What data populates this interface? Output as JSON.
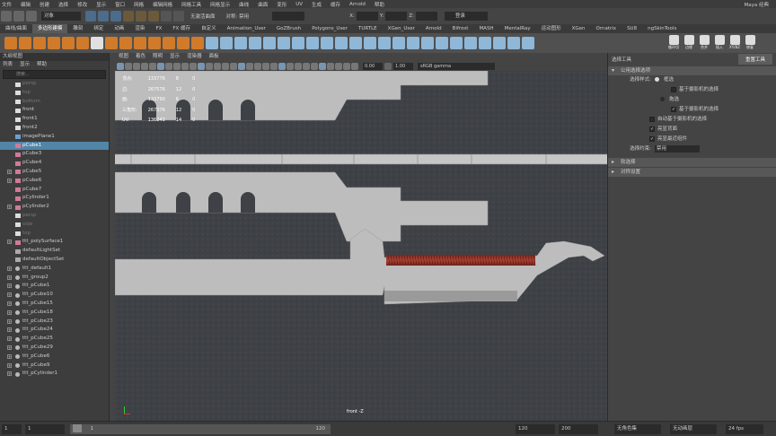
{
  "menubar": {
    "items": [
      "文件",
      "编辑",
      "创建",
      "选择",
      "修改",
      "显示",
      "窗口",
      "网格",
      "编辑网格",
      "网格工具",
      "网格显示",
      "曲线",
      "曲面",
      "变形",
      "UV",
      "生成",
      "缓存",
      "Arnold",
      "帮助"
    ],
    "workspace_label": "Maya 经典"
  },
  "statusline": {
    "mode_label": "对象",
    "live_surface": "无激活曲面",
    "symmetry": "对称: 禁用",
    "login": "登录",
    "coord_x": "X:",
    "coord_y": "Y:",
    "coord_z": "Z:"
  },
  "shelf_tabs": [
    "曲线/曲面",
    "多边形建模",
    "雕刻",
    "绑定",
    "动画",
    "渲染",
    "FX",
    "FX 缓存",
    "自定义",
    "Animation_User",
    "GoZBrush",
    "Polygons_User",
    "TURTLE",
    "XGen_User",
    "Arnold",
    "Bifrost",
    "MASH",
    "MentalRay",
    "运动图形",
    "XGen",
    "Ornatrix",
    "SU8",
    "ngSkinTools"
  ],
  "shelf_active_tab_index": 1,
  "shelf_right_labels": [
    "循环切",
    "边缘",
    "合并",
    "插入",
    "XY/BZ",
    "修复"
  ],
  "outliner": {
    "title": "大纲视图",
    "menu": [
      "列表",
      "显示",
      "帮助"
    ],
    "search_placeholder": "搜索...",
    "rows": [
      {
        "label": "persp",
        "kind": "camera",
        "dim": true,
        "expand": false
      },
      {
        "label": "top",
        "kind": "camera",
        "dim": true,
        "expand": false
      },
      {
        "label": "bottom",
        "kind": "camera",
        "dim": true,
        "expand": false
      },
      {
        "label": "front",
        "kind": "camera",
        "dim": false,
        "expand": false
      },
      {
        "label": "front1",
        "kind": "camera",
        "dim": false,
        "expand": false
      },
      {
        "label": "front2",
        "kind": "camera",
        "dim": false,
        "expand": false
      },
      {
        "label": "imagePlane1",
        "kind": "image",
        "dim": false,
        "expand": false
      },
      {
        "label": "pCube1",
        "kind": "mesh",
        "dim": false,
        "expand": false,
        "selected": true
      },
      {
        "label": "pCube3",
        "kind": "mesh",
        "dim": false,
        "expand": false
      },
      {
        "label": "pCube4",
        "kind": "mesh",
        "dim": false,
        "expand": false
      },
      {
        "label": "pCube5",
        "kind": "mesh",
        "dim": false,
        "expand": true
      },
      {
        "label": "pCube6",
        "kind": "mesh",
        "dim": false,
        "expand": true
      },
      {
        "label": "pCube7",
        "kind": "mesh",
        "dim": false,
        "expand": false
      },
      {
        "label": "pCylinder1",
        "kind": "mesh",
        "dim": false,
        "expand": false
      },
      {
        "label": "pCylinder2",
        "kind": "mesh",
        "dim": false,
        "expand": true
      },
      {
        "label": "persp",
        "kind": "camera",
        "dim": true,
        "expand": false
      },
      {
        "label": "side",
        "kind": "camera",
        "dim": true,
        "expand": false
      },
      {
        "label": "top",
        "kind": "camera",
        "dim": true,
        "expand": false
      },
      {
        "label": "ttt_polySurface1",
        "kind": "mesh",
        "dim": false,
        "expand": true
      },
      {
        "label": "defaultLightSet",
        "kind": "set",
        "dim": false,
        "expand": false
      },
      {
        "label": "defaultObjectSet",
        "kind": "set",
        "dim": false,
        "expand": false
      },
      {
        "label": "ttt_default1",
        "kind": "group",
        "dim": false,
        "expand": true
      },
      {
        "label": "ttt_group2",
        "kind": "group",
        "dim": false,
        "expand": true
      },
      {
        "label": "ttt_pCube1",
        "kind": "group",
        "dim": false,
        "expand": true
      },
      {
        "label": "ttt_pCube10",
        "kind": "group",
        "dim": false,
        "expand": true
      },
      {
        "label": "ttt_pCube15",
        "kind": "group",
        "dim": false,
        "expand": true
      },
      {
        "label": "ttt_pCube18",
        "kind": "group",
        "dim": false,
        "expand": true
      },
      {
        "label": "ttt_pCube23",
        "kind": "group",
        "dim": false,
        "expand": true
      },
      {
        "label": "ttt_pCube24",
        "kind": "group",
        "dim": false,
        "expand": true
      },
      {
        "label": "ttt_pCube25",
        "kind": "group",
        "dim": false,
        "expand": true
      },
      {
        "label": "ttt_pCube29",
        "kind": "group",
        "dim": false,
        "expand": true
      },
      {
        "label": "ttt_pCube6",
        "kind": "group",
        "dim": false,
        "expand": true
      },
      {
        "label": "ttt_pCube9",
        "kind": "group",
        "dim": false,
        "expand": true
      },
      {
        "label": "ttt_pCylinder1",
        "kind": "group",
        "dim": false,
        "expand": true
      }
    ]
  },
  "viewport": {
    "menu": [
      "视图",
      "着色",
      "照明",
      "显示",
      "渲染器",
      "面板"
    ],
    "exposure": "0.00",
    "gamma": "1.00",
    "color_space": "sRGB gamma",
    "camera_label": "front -Z",
    "hud": [
      [
        "顶点:",
        "133776",
        "8",
        "0"
      ],
      [
        "边:",
        "267576",
        "12",
        "0"
      ],
      [
        "面:",
        "133790",
        "6",
        "0"
      ],
      [
        "三角形:",
        "267376",
        "12",
        "0"
      ],
      [
        "UV:",
        "136243",
        "14",
        "0"
      ]
    ]
  },
  "attr": {
    "title": "选择工具",
    "reset_button": "重置工具",
    "section_common": "公用选择选项",
    "selection_style_label": "选择样式:",
    "opt_marquee": "框选",
    "opt_camera_based_1": "基于摄影机的选择",
    "opt_drag": "拖选",
    "opt_camera_based_2": "基于摄影机的选择",
    "opt_auto_camera": "自动基于摄影机的选择",
    "opt_highlight_back": "亮显背面",
    "opt_highlight_nearest": "亮显最近组件",
    "constraint_label": "选择约束:",
    "constraint_value": "禁用",
    "section_soft": "软选择",
    "section_symmetry": "对称设置"
  },
  "timebar": {
    "start_outer": "1",
    "start_inner": "1",
    "current_frame": "1",
    "range_end_inner": "120",
    "end_inner": "120",
    "end_outer": "200",
    "anim_layer": "无角色集",
    "anim_layer2": "无动画层",
    "fps": "24 fps"
  },
  "colors": {
    "accent_select": "#5285a6",
    "viewport_bg": "#3f4248",
    "model_gray": "#bdbdbd",
    "spring_red": "#9a3326"
  }
}
